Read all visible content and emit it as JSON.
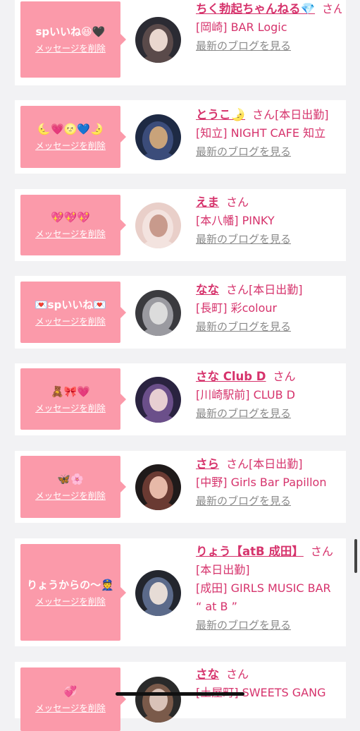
{
  "delete_label": "メッセージを削除",
  "blog_label": "最新のブログを見る",
  "san_label": "さん",
  "colors": {
    "accent": "#d6336c",
    "message_bg": "#fb9aaa",
    "blog_link": "#8a8a8a",
    "background": "#f2f2f4"
  },
  "messages": [
    {
      "text": "spいいね😆🖤",
      "name": "ちく勃起ちゃんねる💎",
      "status": "",
      "shop": "[岡崎] BAR Logic",
      "avatar_palette": [
        "#2b2b33",
        "#e9d7cf",
        "#5a4a4a"
      ]
    },
    {
      "text": "🌜💗🌝💙🌛",
      "name": "とうこ🌛",
      "status": "[本日出勤]",
      "shop": "[知立] NIGHT CAFE 知立",
      "avatar_palette": [
        "#1e2a44",
        "#c9a37a",
        "#3b4c7a"
      ]
    },
    {
      "text": "💖💖💖",
      "name": "えま",
      "status": "",
      "shop": "[本八幡] PINKY",
      "avatar_palette": [
        "#e9cfc9",
        "#c89a8c",
        "#f3e3df"
      ]
    },
    {
      "text": "💌spいいね💌",
      "name": "なな",
      "status": "[本日出勤]",
      "shop": "[長町] 彩colour",
      "avatar_palette": [
        "#3a3a3e",
        "#dcdcdc",
        "#9a9aa0"
      ]
    },
    {
      "text": "🧸🎀💗",
      "name": "さな Club D",
      "status": "",
      "shop": "[川崎駅前] CLUB D",
      "avatar_palette": [
        "#2a2340",
        "#e7cfd2",
        "#6b4f8a"
      ]
    },
    {
      "text": "🦋🌸",
      "name": "さら",
      "status": "[本日出勤]",
      "shop": "[中野] Girls Bar Papillon",
      "avatar_palette": [
        "#1f1a1a",
        "#e7b9a8",
        "#6a3a32"
      ]
    },
    {
      "text": "りょうからの〜👮",
      "name": "りょう【atB 成田】",
      "status": "[本日出勤]",
      "shop": "[成田] GIRLS MUSIC BAR “ at B ”",
      "avatar_palette": [
        "#23262e",
        "#e6dcd6",
        "#5b6a8a"
      ]
    },
    {
      "text": "💞",
      "name": "さな",
      "status": "",
      "shop": "[土屋町] SWEETS GANG",
      "avatar_palette": [
        "#2a2a2a",
        "#d9c2b8",
        "#7a5a4a"
      ]
    }
  ]
}
